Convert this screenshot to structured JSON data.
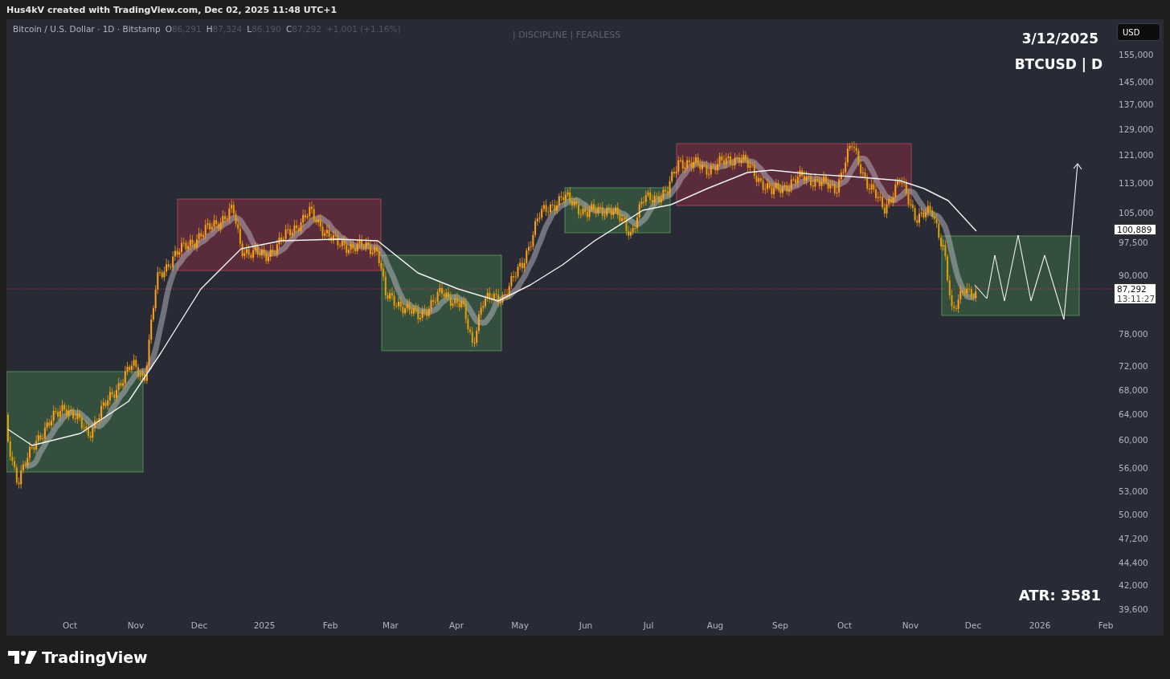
{
  "header": {
    "caption": "Hus4kV created with TradingView.com, Dec 02, 2025 11:48 UTC+1"
  },
  "legend": {
    "symbol": "Bitcoin / U.S. Dollar · 1D · Bitstamp",
    "values": [
      {
        "label": "O",
        "value": "86,291"
      },
      {
        "label": "H",
        "value": "87,324"
      },
      {
        "label": "L",
        "value": "86,190"
      },
      {
        "label": "C",
        "value": "87,292"
      }
    ],
    "change": "+1,001 (+1.16%)"
  },
  "watermark": "| DISCIPLINE | FEARLESS",
  "info": {
    "date": "3/12/2025",
    "ticker": "BTCUSD | D",
    "atr": "ATR: 3581"
  },
  "currency_button": "USD",
  "price_axis": [
    "155,000",
    "145,000",
    "137,000",
    "129,000",
    "121,000",
    "113,000",
    "105,000",
    "97,500",
    "90,000",
    "78,000",
    "72,000",
    "68,000",
    "64,000",
    "60,000",
    "56,000",
    "53,000",
    "50,000",
    "47,200",
    "44,400",
    "42,000",
    "39,600"
  ],
  "price_labels": [
    {
      "kind": "ma",
      "price": "100,889"
    },
    {
      "kind": "last",
      "price": "87,292",
      "countdown": "13:11:27"
    }
  ],
  "time_axis": [
    "Oct",
    "Nov",
    "Dec",
    "2025",
    "Feb",
    "Mar",
    "Apr",
    "May",
    "Jun",
    "Jul",
    "Aug",
    "Sep",
    "Oct",
    "Nov",
    "Dec",
    "2026",
    "Feb"
  ],
  "footer": {
    "brand": "TradingView"
  }
}
